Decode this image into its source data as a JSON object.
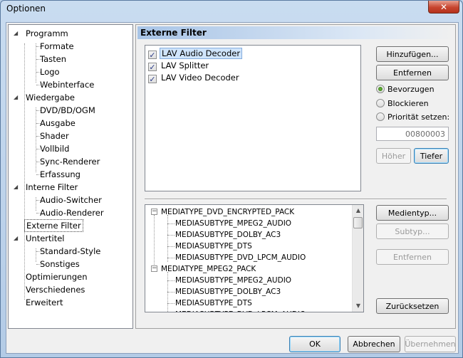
{
  "window": {
    "title": "Optionen"
  },
  "tree": {
    "items": [
      {
        "label": "Programm",
        "level": 0,
        "expanded": true
      },
      {
        "label": "Formate",
        "level": 1
      },
      {
        "label": "Tasten",
        "level": 1
      },
      {
        "label": "Logo",
        "level": 1
      },
      {
        "label": "Webinterface",
        "level": 1
      },
      {
        "label": "Wiedergabe",
        "level": 0,
        "expanded": true
      },
      {
        "label": "DVD/BD/OGM",
        "level": 1
      },
      {
        "label": "Ausgabe",
        "level": 1
      },
      {
        "label": "Shader",
        "level": 1
      },
      {
        "label": "Vollbild",
        "level": 1
      },
      {
        "label": "Sync-Renderer",
        "level": 1
      },
      {
        "label": "Erfassung",
        "level": 1
      },
      {
        "label": "Interne Filter",
        "level": 0,
        "expanded": true
      },
      {
        "label": "Audio-Switcher",
        "level": 1
      },
      {
        "label": "Audio-Renderer",
        "level": 1
      },
      {
        "label": "Externe Filter",
        "level": 0,
        "selected": true
      },
      {
        "label": "Untertitel",
        "level": 0,
        "expanded": true
      },
      {
        "label": "Standard-Style",
        "level": 1
      },
      {
        "label": "Sonstiges",
        "level": 1
      },
      {
        "label": "Optimierungen",
        "level": 0
      },
      {
        "label": "Verschiedenes",
        "level": 0
      },
      {
        "label": "Erweitert",
        "level": 0
      }
    ]
  },
  "panel": {
    "header": "Externe Filter",
    "filters": [
      {
        "label": "LAV Audio Decoder",
        "checked": true,
        "selected": true
      },
      {
        "label": "LAV Splitter",
        "checked": true
      },
      {
        "label": "LAV Video Decoder",
        "checked": true
      }
    ],
    "buttons": {
      "add": "Hinzufügen...",
      "remove": "Entfernen",
      "up": "Höher",
      "down": "Tiefer",
      "media_type": "Medientyp...",
      "subtype": "Subtyp...",
      "remove_type": "Entfernen",
      "reset": "Zurücksetzen"
    },
    "radios": [
      {
        "label": "Bevorzugen",
        "checked": true
      },
      {
        "label": "Blockieren",
        "checked": false
      },
      {
        "label": "Priorität setzen:",
        "checked": false
      }
    ],
    "priority_value": "00800003",
    "media_types": [
      {
        "label": "MEDIATYPE_DVD_ENCRYPTED_PACK",
        "level": 0
      },
      {
        "label": "MEDIASUBTYPE_MPEG2_AUDIO",
        "level": 1
      },
      {
        "label": "MEDIASUBTYPE_DOLBY_AC3",
        "level": 1
      },
      {
        "label": "MEDIASUBTYPE_DTS",
        "level": 1
      },
      {
        "label": "MEDIASUBTYPE_DVD_LPCM_AUDIO",
        "level": 1
      },
      {
        "label": "MEDIATYPE_MPEG2_PACK",
        "level": 0
      },
      {
        "label": "MEDIASUBTYPE_MPEG2_AUDIO",
        "level": 1
      },
      {
        "label": "MEDIASUBTYPE_DOLBY_AC3",
        "level": 1
      },
      {
        "label": "MEDIASUBTYPE_DTS",
        "level": 1
      },
      {
        "label": "MEDIASUBTYPE_DVD_LPCM_AUDIO",
        "level": 1
      }
    ]
  },
  "footer": {
    "ok": "OK",
    "cancel": "Abbrechen",
    "apply": "Übernehmen"
  }
}
